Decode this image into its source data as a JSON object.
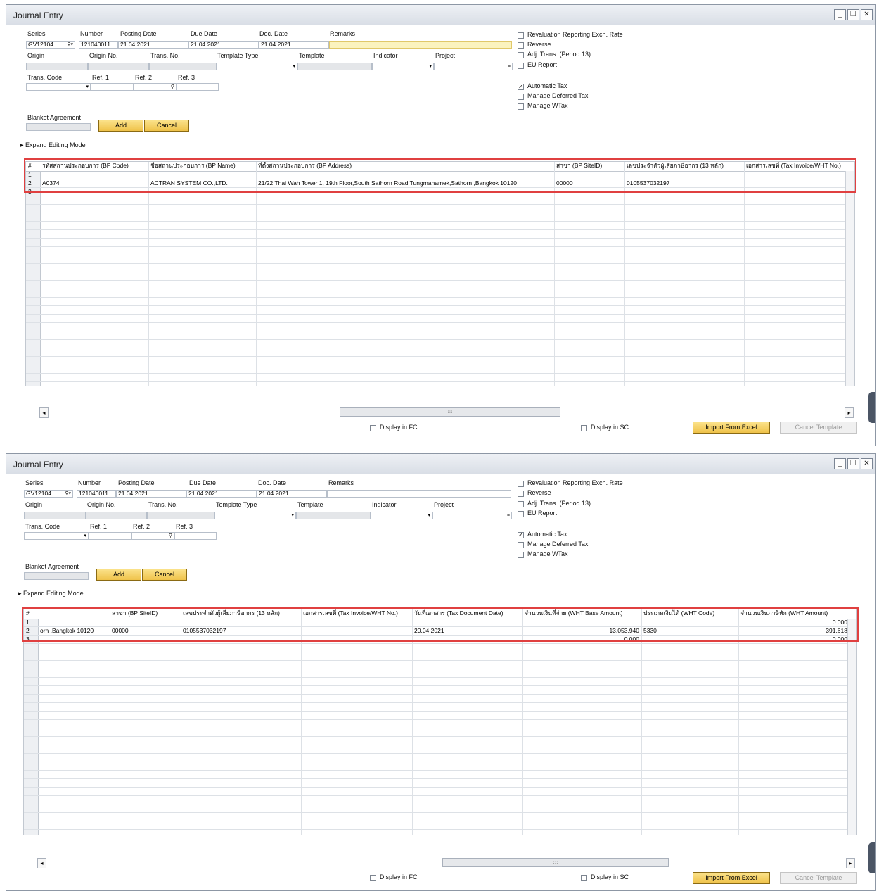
{
  "window_title": "Journal Entry",
  "header": {
    "series_label": "Series",
    "series_value": "GV12104",
    "number_label": "Number",
    "number_value": "121040011",
    "posting_date_label": "Posting Date",
    "posting_date_value": "21.04.2021",
    "due_date_label": "Due Date",
    "due_date_value": "21.04.2021",
    "doc_date_label": "Doc. Date",
    "doc_date_value": "21.04.2021",
    "remarks_label": "Remarks",
    "origin_label": "Origin",
    "origin_no_label": "Origin No.",
    "trans_no_label": "Trans. No.",
    "template_type_label": "Template Type",
    "template_label": "Template",
    "indicator_label": "Indicator",
    "project_label": "Project",
    "trans_code_label": "Trans. Code",
    "ref1_label": "Ref. 1",
    "ref2_label": "Ref. 2",
    "ref3_label": "Ref. 3",
    "blanket_label": "Blanket Agreement"
  },
  "checkboxes": {
    "reval": "Revaluation Reporting Exch. Rate",
    "reverse": "Reverse",
    "adj": "Adj. Trans. (Period 13)",
    "eu": "EU Report",
    "auto_tax": "Automatic Tax",
    "deferred": "Manage Deferred Tax",
    "wtax": "Manage WTax"
  },
  "buttons": {
    "add": "Add",
    "cancel": "Cancel",
    "expand": "Expand Editing Mode",
    "import": "Import From Excel",
    "cancel_template": "Cancel Template",
    "display_fc": "Display in FC",
    "display_sc": "Display in SC"
  },
  "grid1": {
    "headers": [
      "#",
      "รหัสสถานประกอบการ (BP Code)",
      "ชื่อสถานประกอบการ (BP Name)",
      "ที่ตั้งสถานประกอบการ (BP Address)",
      "สาขา (BP SiteID)",
      "เลขประจำตัวผู้เสียภาษีอากร (13 หลัก)",
      "เอกสารเลขที่ (Tax Invoice/WHT No.)"
    ],
    "rows": [
      [
        "1",
        "",
        "",
        "",
        "",
        "",
        ""
      ],
      [
        "2",
        "A0374",
        "ACTRAN SYSTEM CO.,LTD.",
        "21/22 Thai Wah Tower 1, 19th Floor,South Sathorn Road Tungmahamek,Sathorn ,Bangkok 10120",
        "00000",
        "0105537032197",
        ""
      ],
      [
        "3",
        "",
        "",
        "",
        "",
        "",
        ""
      ]
    ]
  },
  "grid2": {
    "headers": [
      "#",
      "",
      "สาขา (BP SiteID)",
      "เลขประจำตัวผู้เสียภาษีอากร (13 หลัก)",
      "เอกสารเลขที่ (Tax Invoice/WHT No.)",
      "วันที่เอกสาร (Tax Document Date)",
      "จำนวนเงินที่จ่าย (WHT Base Amount)",
      "ประเภทเงินได้ (WHT Code)",
      "จำนวนเงินภาษีหัก (WHT Amount)"
    ],
    "rows": [
      [
        "1",
        "",
        "",
        "",
        "",
        "",
        "",
        "",
        "0.000"
      ],
      [
        "2",
        "orn ,Bangkok 10120",
        "00000",
        "0105537032197",
        "",
        "20.04.2021",
        "13,053.940",
        "5330",
        "391.618"
      ],
      [
        "3",
        "",
        "",
        "",
        "",
        "",
        "0.000",
        "",
        "0.000"
      ]
    ]
  }
}
